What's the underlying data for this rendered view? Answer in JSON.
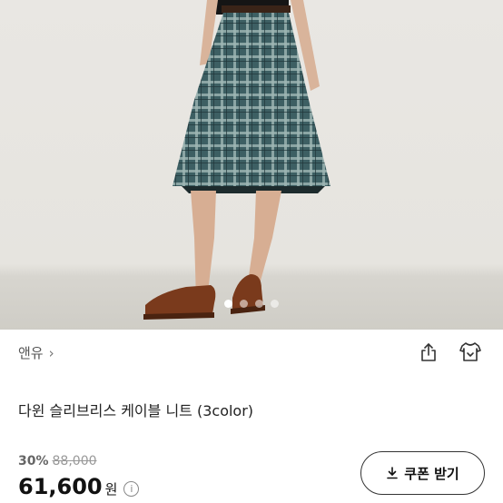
{
  "hero": {
    "image": "product-photo-plaid-skirt",
    "carousel": {
      "count": 4,
      "active": 0
    }
  },
  "brand": {
    "name": "앤유",
    "chevron": "›"
  },
  "actions": {
    "share_icon": "share-icon",
    "closet_icon": "hanger-icon"
  },
  "product": {
    "title": "다윈 슬리브리스 케이블 니트 (3color)"
  },
  "pricing": {
    "discount": "30%",
    "original_price": "88,000",
    "sale_price": "61,600",
    "currency": "원",
    "info_icon": "i"
  },
  "coupon": {
    "label": "쿠폰 받기",
    "icon": "download-icon"
  }
}
